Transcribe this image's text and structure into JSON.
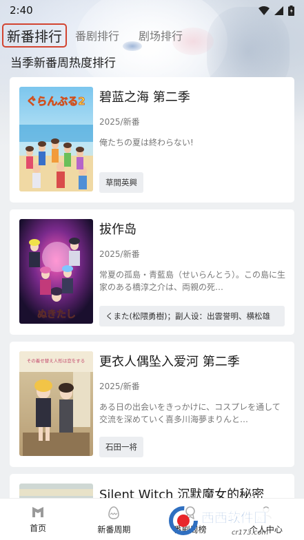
{
  "status_bar": {
    "time": "2:40"
  },
  "tabs": [
    {
      "label": "新番排行"
    },
    {
      "label": "番剧排行"
    },
    {
      "label": "剧场排行"
    }
  ],
  "section_title": "当季新番周热度排行",
  "cards": [
    {
      "title": "碧蓝之海 第二季",
      "year": "2025/新番",
      "desc": "俺たちの夏は終わらない!",
      "tag": "草間英興",
      "poster_text": "ぐらんぶる2"
    },
    {
      "title": "拔作岛",
      "year": "2025/新番",
      "desc": "常夏の孤島・青藍島（せいらんとう）。この島に生家のある橋淳之介は、両親の死…",
      "tag": "くまた(松隈勇樹)；副人设：出雲誉明、横松雄",
      "poster_text": "ぬきたし"
    },
    {
      "title": "更衣人偶坠入爱河 第二季",
      "year": "2025/新番",
      "desc": "ある日の出会いをきっかけに、コスプレを通して交流を深めていく喜多川海夢まりんと…",
      "tag": "石田一将",
      "poster_text": "その着せ替え人形は恋をする"
    },
    {
      "title": "Silent Witch 沉默魔女的秘密"
    }
  ],
  "bottom_nav": [
    {
      "label": "首页",
      "icon": "home-icon"
    },
    {
      "label": "新番周期",
      "icon": "egg-icon"
    },
    {
      "label": "番剧周榜",
      "icon": "ribbon-icon"
    },
    {
      "label": "个人中心",
      "icon": "person-icon"
    }
  ],
  "watermark": {
    "site": "西西软件园",
    "url": "cr173.com"
  }
}
